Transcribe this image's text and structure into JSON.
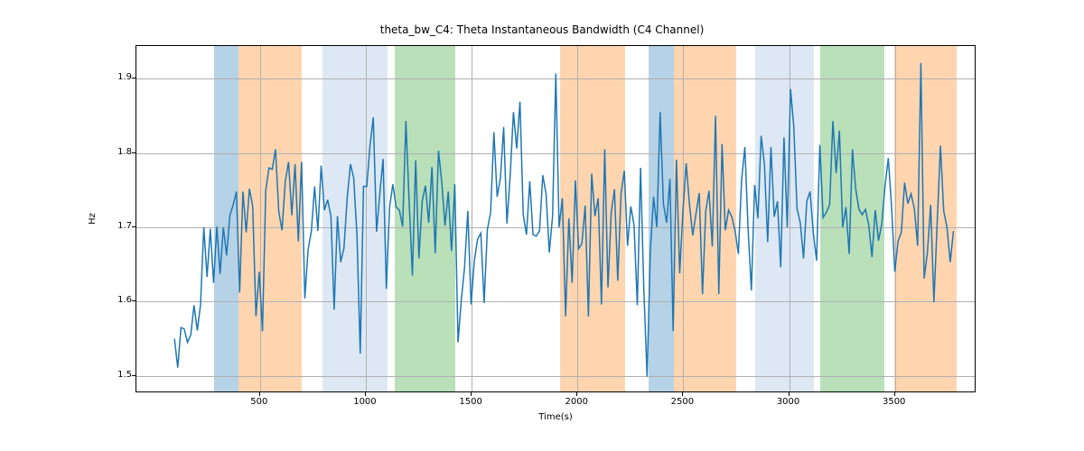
{
  "chart_data": {
    "type": "line",
    "title": "theta_bw_C4: Theta Instantaneous Bandwidth (C4 Channel)",
    "xlabel": "Time(s)",
    "ylabel": "Hz",
    "xlim": [
      -83.85,
      3876.85
    ],
    "ylim": [
      1.4789,
      1.944
    ],
    "xticks": [
      500,
      1000,
      1500,
      2000,
      2500,
      3000,
      3500
    ],
    "yticks": [
      1.5,
      1.6,
      1.7,
      1.8,
      1.9
    ],
    "bands": [
      {
        "x0": 282,
        "x1": 399,
        "color": "#1f77b4",
        "alpha": 0.33
      },
      {
        "x0": 399,
        "x1": 697,
        "color": "#ff7f0e",
        "alpha": 0.33
      },
      {
        "x0": 796,
        "x1": 1104,
        "color": "#c7d8ec",
        "alpha": 0.6
      },
      {
        "x0": 1104,
        "x1": 1135,
        "color": "#ffffff",
        "alpha": 0.0
      },
      {
        "x0": 1135,
        "x1": 1423,
        "color": "#2ca02c",
        "alpha": 0.33
      },
      {
        "x0": 1918,
        "x1": 2226,
        "color": "#ff7f0e",
        "alpha": 0.33
      },
      {
        "x0": 2336,
        "x1": 2454,
        "color": "#1f77b4",
        "alpha": 0.33
      },
      {
        "x0": 2454,
        "x1": 2750,
        "color": "#ff7f0e",
        "alpha": 0.33
      },
      {
        "x0": 2838,
        "x1": 3118,
        "color": "#c7d8ec",
        "alpha": 0.6
      },
      {
        "x0": 3148,
        "x1": 3118,
        "color": "#ffffff",
        "alpha": 0.0
      },
      {
        "x0": 3148,
        "x1": 3448,
        "color": "#2ca02c",
        "alpha": 0.33
      },
      {
        "x0": 3497,
        "x1": 3793,
        "color": "#ff7f0e",
        "alpha": 0.33
      }
    ],
    "series": [
      {
        "name": "theta_bw_C4",
        "color": "#1f77b4",
        "x_start": 96,
        "x_step": 15.4,
        "values": [
          1.55,
          1.511,
          1.565,
          1.563,
          1.545,
          1.555,
          1.595,
          1.561,
          1.596,
          1.7,
          1.633,
          1.698,
          1.625,
          1.701,
          1.637,
          1.7,
          1.662,
          1.716,
          1.73,
          1.748,
          1.612,
          1.748,
          1.693,
          1.752,
          1.728,
          1.58,
          1.64,
          1.56,
          1.749,
          1.78,
          1.778,
          1.805,
          1.721,
          1.696,
          1.762,
          1.788,
          1.716,
          1.785,
          1.681,
          1.788,
          1.604,
          1.67,
          1.695,
          1.755,
          1.695,
          1.783,
          1.723,
          1.737,
          1.715,
          1.589,
          1.715,
          1.653,
          1.672,
          1.74,
          1.785,
          1.766,
          1.688,
          1.53,
          1.755,
          1.755,
          1.81,
          1.848,
          1.694,
          1.745,
          1.792,
          1.617,
          1.727,
          1.758,
          1.727,
          1.723,
          1.701,
          1.843,
          1.735,
          1.635,
          1.79,
          1.658,
          1.735,
          1.756,
          1.706,
          1.781,
          1.665,
          1.803,
          1.761,
          1.702,
          1.748,
          1.668,
          1.758,
          1.545,
          1.602,
          1.646,
          1.722,
          1.596,
          1.655,
          1.684,
          1.692,
          1.598,
          1.697,
          1.72,
          1.828,
          1.741,
          1.766,
          1.835,
          1.705,
          1.77,
          1.855,
          1.806,
          1.869,
          1.717,
          1.69,
          1.762,
          1.69,
          1.688,
          1.695,
          1.77,
          1.745,
          1.666,
          1.715,
          1.907,
          1.7,
          1.739,
          1.58,
          1.712,
          1.625,
          1.763,
          1.671,
          1.678,
          1.729,
          1.58,
          1.772,
          1.715,
          1.739,
          1.596,
          1.805,
          1.619,
          1.72,
          1.751,
          1.628,
          1.745,
          1.776,
          1.675,
          1.728,
          1.703,
          1.595,
          1.78,
          1.616,
          1.499,
          1.668,
          1.741,
          1.7,
          1.855,
          1.732,
          1.706,
          1.765,
          1.56,
          1.791,
          1.638,
          1.722,
          1.786,
          1.731,
          1.689,
          1.718,
          1.746,
          1.61,
          1.722,
          1.749,
          1.674,
          1.85,
          1.61,
          1.812,
          1.696,
          1.723,
          1.714,
          1.695,
          1.664,
          1.764,
          1.808,
          1.696,
          1.615,
          1.757,
          1.712,
          1.823,
          1.785,
          1.68,
          1.808,
          1.714,
          1.735,
          1.646,
          1.821,
          1.7,
          1.886,
          1.836,
          1.725,
          1.706,
          1.658,
          1.735,
          1.748,
          1.692,
          1.655,
          1.811,
          1.713,
          1.72,
          1.73,
          1.843,
          1.773,
          1.83,
          1.7,
          1.727,
          1.664,
          1.805,
          1.752,
          1.724,
          1.717,
          1.724,
          1.703,
          1.66,
          1.723,
          1.682,
          1.704,
          1.756,
          1.793,
          1.728,
          1.64,
          1.681,
          1.693,
          1.76,
          1.732,
          1.745,
          1.725,
          1.675,
          1.921,
          1.631,
          1.666,
          1.73,
          1.599,
          1.706,
          1.81,
          1.722,
          1.7,
          1.653,
          1.695
        ]
      }
    ]
  }
}
